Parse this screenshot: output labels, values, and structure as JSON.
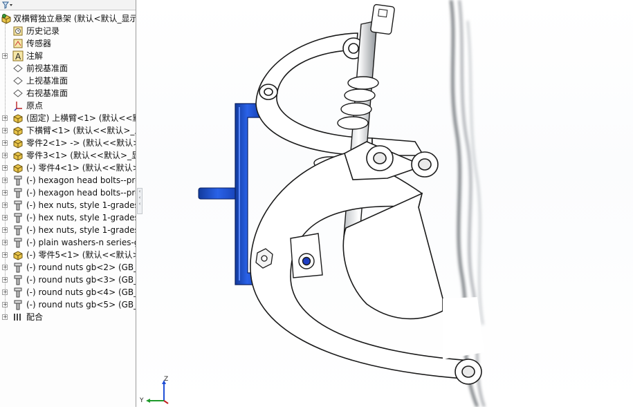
{
  "feature_tree": {
    "root": {
      "label": "双横臂独立悬架 (默认<默认_显示",
      "icon": "assembly-icon",
      "expanded": true
    },
    "items": [
      {
        "label": "历史记录",
        "icon": "history-icon",
        "expander": false
      },
      {
        "label": "传感器",
        "icon": "sensor-icon",
        "expander": false
      },
      {
        "label": "注解",
        "icon": "annotation-icon",
        "expander": true
      },
      {
        "label": "前视基准面",
        "icon": "plane-icon",
        "expander": false
      },
      {
        "label": "上视基准面",
        "icon": "plane-icon",
        "expander": false
      },
      {
        "label": "右视基准面",
        "icon": "plane-icon",
        "expander": false
      },
      {
        "label": "原点",
        "icon": "origin-icon",
        "expander": false
      },
      {
        "label": "(固定) 上横臂<1> (默认<<默认",
        "icon": "part-icon",
        "expander": true
      },
      {
        "label": "下横臂<1> (默认<<默认>_显",
        "icon": "part-icon",
        "expander": true
      },
      {
        "label": "零件2<1> -> (默认<<默认>_",
        "icon": "part-icon",
        "expander": true
      },
      {
        "label": "零件3<1> (默认<<默认>_显示",
        "icon": "part-icon",
        "expander": true
      },
      {
        "label": "(-) 零件4<1> (默认<<默认>_",
        "icon": "part-icon",
        "expander": true
      },
      {
        "label": "(-) hexagon head bolts--pro",
        "icon": "bolt-icon",
        "expander": true
      },
      {
        "label": "(-) hexagon head bolts--pro",
        "icon": "bolt-icon",
        "expander": true
      },
      {
        "label": "(-) hex nuts, style 1-grades",
        "icon": "bolt-icon",
        "expander": true
      },
      {
        "label": "(-) hex nuts, style 1-grades",
        "icon": "bolt-icon",
        "expander": true
      },
      {
        "label": "(-) hex nuts, style 1-grades",
        "icon": "bolt-icon",
        "expander": true
      },
      {
        "label": "(-) plain washers-n series-g",
        "icon": "bolt-icon",
        "expander": true
      },
      {
        "label": "(-) 零件5<1> (默认<<默认>_",
        "icon": "part-icon",
        "expander": true
      },
      {
        "label": "(-) round nuts gb<2> (GB_F",
        "icon": "bolt-icon",
        "expander": true
      },
      {
        "label": "(-) round nuts gb<3> (GB_F",
        "icon": "bolt-icon",
        "expander": true
      },
      {
        "label": "(-) round nuts gb<4> (GB_F",
        "icon": "bolt-icon",
        "expander": true
      },
      {
        "label": "(-) round nuts gb<5> (GB_F",
        "icon": "bolt-icon",
        "expander": true
      },
      {
        "label": "配合",
        "icon": "mates-icon",
        "expander": true
      }
    ]
  },
  "triad": {
    "z_label": "Z",
    "y_label": "Y"
  },
  "colors": {
    "part_white": "#ffffff",
    "part_edge": "#1a1a1a",
    "blue_bracket": "#1f4fd6",
    "tree_text": "#111111",
    "folder_yellow": "#e8c44a"
  }
}
